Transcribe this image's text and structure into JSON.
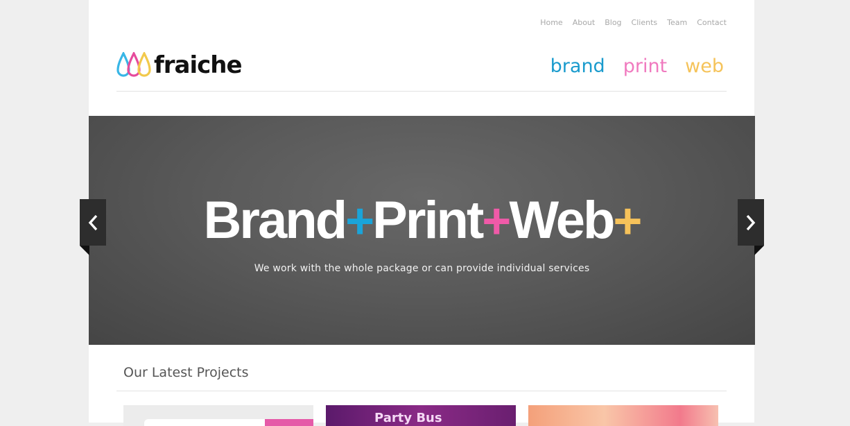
{
  "top_nav": [
    "Home",
    "About",
    "Blog",
    "Clients",
    "Team",
    "Contact"
  ],
  "brand": {
    "logo_text": "fraiche",
    "logo_colors": [
      "#38b6e6",
      "#e64b9c",
      "#f2c94c"
    ]
  },
  "services": [
    {
      "label": "brand",
      "color": "#1a9bcd"
    },
    {
      "label": "print",
      "color": "#f07abf"
    },
    {
      "label": "web",
      "color": "#f5c35a"
    }
  ],
  "hero": {
    "words": [
      "Brand",
      "Print",
      "Web"
    ],
    "plus": "+",
    "plus_colors": [
      "#1aa4d9",
      "#f05aa8",
      "#f6c25a"
    ],
    "subtitle": "We work with the whole package or can provide individual services",
    "prev_icon": "chevron-left-icon",
    "next_icon": "chevron-right-icon"
  },
  "projects": {
    "title": "Our Latest Projects",
    "thumb_2_text": "Party Bus"
  }
}
